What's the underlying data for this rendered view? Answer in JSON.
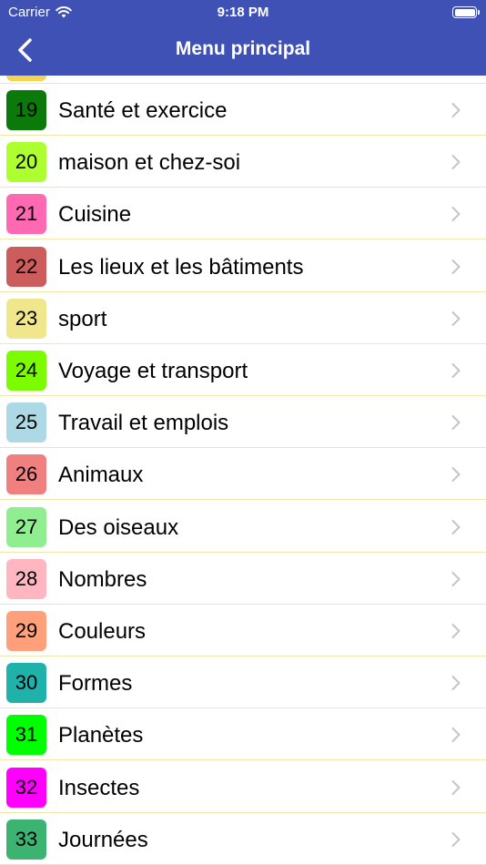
{
  "status": {
    "carrier": "Carrier",
    "time": "9:18 PM"
  },
  "nav": {
    "title": "Menu principal",
    "back_icon": "chevron-left-icon"
  },
  "items": [
    {
      "number": "19",
      "label": "Santé et exercice",
      "color": "#0b7a0b"
    },
    {
      "number": "20",
      "label": "maison et chez-soi",
      "color": "#adff2f"
    },
    {
      "number": "21",
      "label": "Cuisine",
      "color": "#ff69b4"
    },
    {
      "number": "22",
      "label": "Les lieux et les bâtiments",
      "color": "#cd5c5c"
    },
    {
      "number": "23",
      "label": "sport",
      "color": "#f0e68c"
    },
    {
      "number": "24",
      "label": "Voyage et transport",
      "color": "#7cfc00"
    },
    {
      "number": "25",
      "label": "Travail et emplois",
      "color": "#add8e6"
    },
    {
      "number": "26",
      "label": "Animaux",
      "color": "#f08080"
    },
    {
      "number": "27",
      "label": "Des oiseaux",
      "color": "#90ee90"
    },
    {
      "number": "28",
      "label": "Nombres",
      "color": "#ffb6c1"
    },
    {
      "number": "29",
      "label": "Couleurs",
      "color": "#ffa07a"
    },
    {
      "number": "30",
      "label": "Formes",
      "color": "#20b2aa"
    },
    {
      "number": "31",
      "label": "Planètes",
      "color": "#00ff00"
    },
    {
      "number": "32",
      "label": "Insectes",
      "color": "#ff00ff"
    },
    {
      "number": "33",
      "label": "Journées",
      "color": "#3cb371"
    }
  ]
}
